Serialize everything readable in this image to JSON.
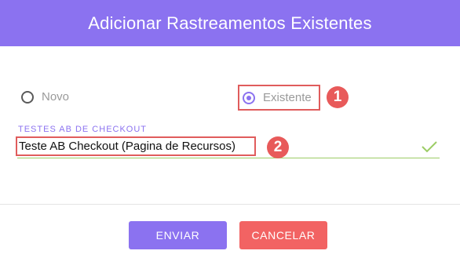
{
  "dialog": {
    "title": "Adicionar Rastreamentos Existentes"
  },
  "radio_group": {
    "options": [
      {
        "label": "Novo",
        "selected": false
      },
      {
        "label": "Existente",
        "selected": true
      }
    ]
  },
  "field": {
    "label": "TESTES AB DE CHECKOUT",
    "value": "Teste AB Checkout (Pagina de Recursos)",
    "valid": true
  },
  "annotations": {
    "badge_1": "1",
    "badge_2": "2"
  },
  "actions": {
    "submit_label": "ENVIAR",
    "cancel_label": "CANCELAR"
  },
  "colors": {
    "accent": "#8b72f0",
    "danger": "#f26363",
    "valid": "#9ccc65",
    "annotation": "#e85a5a"
  }
}
